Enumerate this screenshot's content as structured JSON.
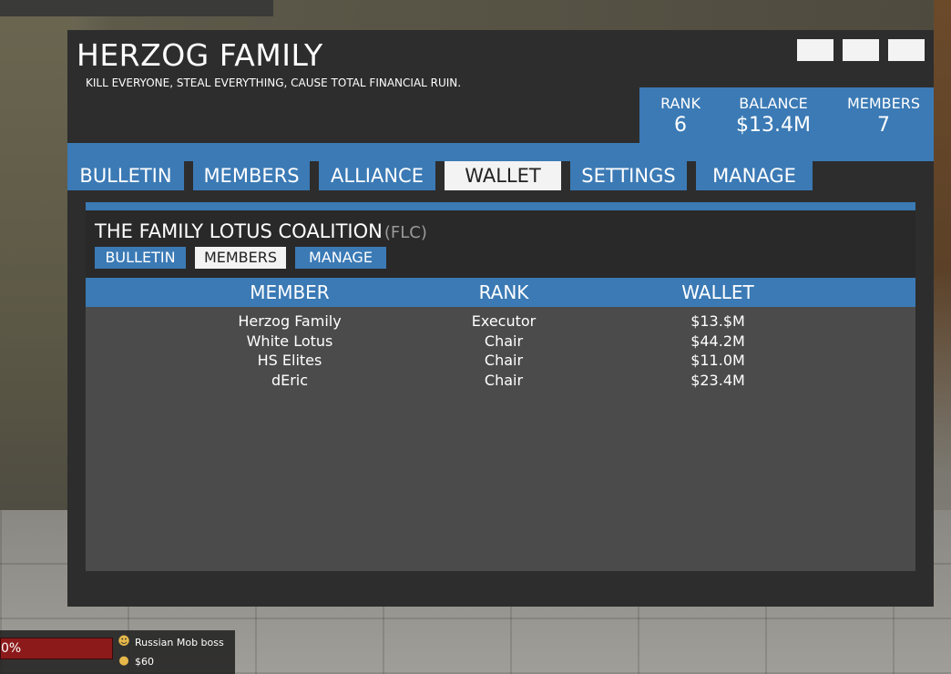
{
  "header": {
    "family_name": "HERZOG FAMILY",
    "motto": "KILL EVERYONE, STEAL EVERYTHING, CAUSE TOTAL FINANCIAL RUIN."
  },
  "stats": {
    "rank_label": "RANK",
    "rank_value": "6",
    "balance_label": "BALANCE",
    "balance_value": "$13.4M",
    "members_label": "MEMBERS",
    "members_value": "7"
  },
  "tabs": [
    {
      "label": "BULLETIN"
    },
    {
      "label": "MEMBERS"
    },
    {
      "label": "ALLIANCE"
    },
    {
      "label": "WALLET",
      "active": true
    },
    {
      "label": "SETTINGS"
    },
    {
      "label": "MANAGE"
    }
  ],
  "alliance": {
    "name": "THE FAMILY LOTUS COALITION",
    "tag": "(FLC)",
    "subtabs": [
      {
        "label": "BULLETIN"
      },
      {
        "label": "MEMBERS",
        "active": true
      },
      {
        "label": "MANAGE"
      }
    ],
    "columns": [
      "MEMBER",
      "RANK",
      "WALLET"
    ],
    "rows": [
      {
        "member": "Herzog Family",
        "rank": "Executor",
        "wallet": "$13.$M"
      },
      {
        "member": "White Lotus",
        "rank": "Chair",
        "wallet": "$44.2M"
      },
      {
        "member": "HS Elites",
        "rank": "Chair",
        "wallet": "$11.0M"
      },
      {
        "member": "dEric",
        "rank": "Chair",
        "wallet": "$23.4M"
      }
    ]
  },
  "hud": {
    "health_text": "0%",
    "job": "Russian Mob boss",
    "money": "$60",
    "health_color": "#8c1a1a"
  },
  "colors": {
    "accent": "#3b7ab5",
    "panel": "#2d2d2d",
    "table_body": "#4b4b4b",
    "active_tab": "#f3f3f3"
  }
}
